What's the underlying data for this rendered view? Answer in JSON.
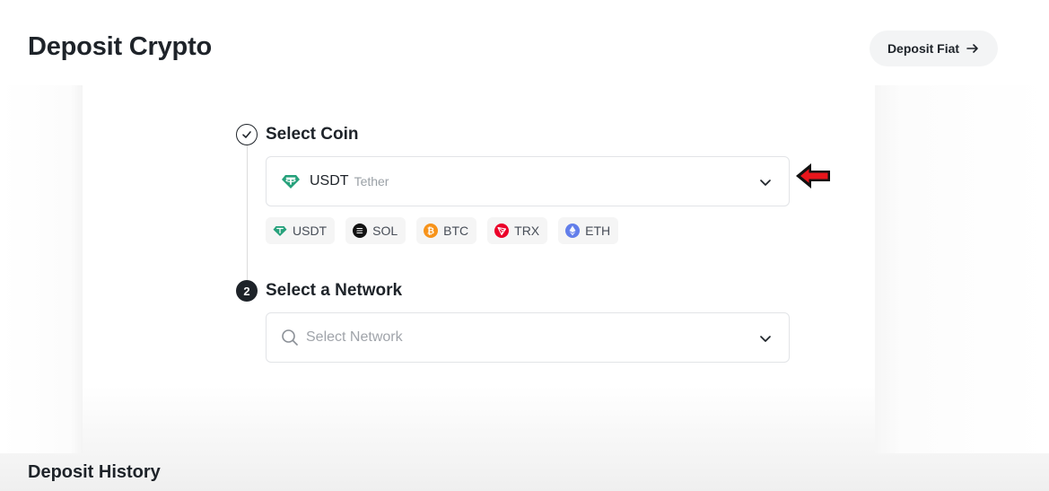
{
  "header": {
    "title": "Deposit Crypto",
    "fiat_button_label": "Deposit Fiat"
  },
  "step1": {
    "title": "Select Coin",
    "selected_symbol": "USDT",
    "selected_name": "Tether"
  },
  "quick_coins": [
    {
      "symbol": "USDT",
      "icon": "usdt-icon",
      "color": "#26a17b"
    },
    {
      "symbol": "SOL",
      "icon": "sol-icon",
      "color": "#121212"
    },
    {
      "symbol": "BTC",
      "icon": "btc-icon",
      "color": "#f7931a"
    },
    {
      "symbol": "TRX",
      "icon": "trx-icon",
      "color": "#eb0029"
    },
    {
      "symbol": "ETH",
      "icon": "eth-icon",
      "color": "#627eea"
    }
  ],
  "step2": {
    "number": "2",
    "title": "Select a Network",
    "placeholder": "Select Network"
  },
  "history": {
    "title": "Deposit History"
  },
  "annotation": {
    "arrow_color": "#e8161c"
  }
}
